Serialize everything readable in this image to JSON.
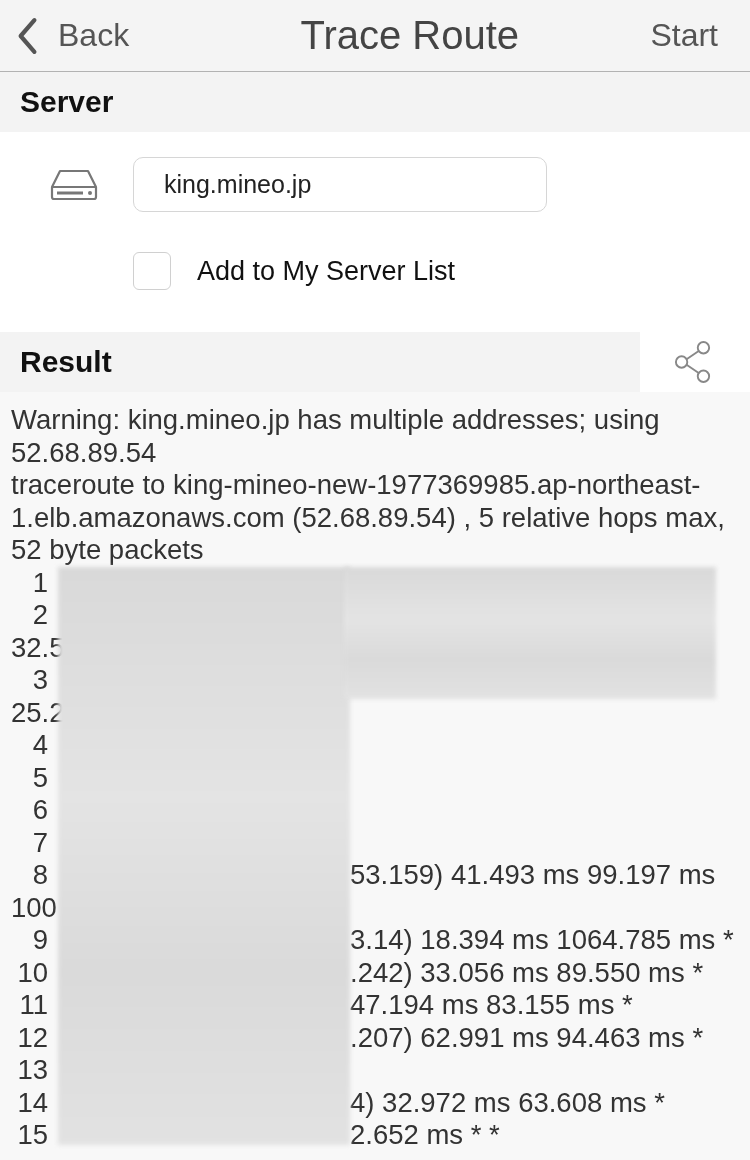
{
  "nav": {
    "back": "Back",
    "title": "Trace Route",
    "action": "Start"
  },
  "server": {
    "heading": "Server",
    "host": "king.mineo.jp",
    "add_to_list": {
      "label": "Add to My Server List",
      "checked": false
    }
  },
  "result": {
    "heading": "Result",
    "lines": [
      {
        "text": "Warning: king.mineo.jp has multiple addresses; using 52.68.89.54"
      },
      {
        "text": "traceroute to king-mineo-new-1977369985.ap-northeast-1.elb.amazonaws.com (52.68.89.54) , 5 relative hops max, 52 byte packets"
      }
    ],
    "hops": [
      {
        "kind": "hop",
        "number": "1"
      },
      {
        "kind": "hop",
        "number": "2"
      },
      {
        "kind": "continuation",
        "text": "32.5"
      },
      {
        "kind": "hop",
        "number": "3"
      },
      {
        "kind": "continuation",
        "text": "25.2"
      },
      {
        "kind": "hop",
        "number": "4"
      },
      {
        "kind": "hop",
        "number": "5"
      },
      {
        "kind": "hop",
        "number": "6"
      },
      {
        "kind": "hop",
        "number": "7"
      },
      {
        "kind": "hop",
        "number": "8",
        "tail": "53.159) 41.493 ms 99.197 ms"
      },
      {
        "kind": "continuation",
        "text": "100"
      },
      {
        "kind": "hop",
        "number": "9",
        "tail": "3.14) 18.394 ms 1064.785 ms *"
      },
      {
        "kind": "hop",
        "number": "10",
        "tail": ".242) 33.056 ms 89.550 ms *"
      },
      {
        "kind": "hop",
        "number": "11",
        "tail": "47.194 ms 83.155 ms *"
      },
      {
        "kind": "hop",
        "number": "12",
        "tail": ".207) 62.991 ms 94.463 ms *"
      },
      {
        "kind": "hop",
        "number": "13"
      },
      {
        "kind": "hop",
        "number": "14",
        "tail": "4) 32.972 ms 63.608 ms *"
      },
      {
        "kind": "hop",
        "number": "15",
        "tail": "2.652 ms * *"
      }
    ]
  }
}
